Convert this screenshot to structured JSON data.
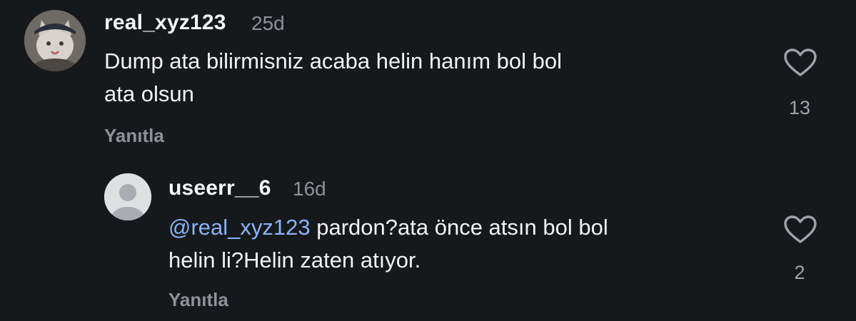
{
  "comments": [
    {
      "username": "real_xyz123",
      "time": "25d",
      "text_lines": [
        "Dump ata bilirmisniz acaba helin hanım bol bol",
        "ata olsun"
      ],
      "reply_label": "Yanıtla",
      "likes": "13",
      "avatar_icon": "cat-photo-avatar"
    },
    {
      "username": "useerr__6",
      "time": "16d",
      "mention": "@real_xyz123",
      "text_line1_rest": " pardon?ata önce atsın bol bol",
      "text_line2": "helin li?Helin zaten atıyor.",
      "reply_label": "Yanıtla",
      "likes": "2",
      "avatar_icon": "default-user-avatar"
    }
  ],
  "icons": {
    "like": "heart-outline-icon"
  },
  "colors": {
    "background": "#16191c",
    "text": "#f2f3f5",
    "muted": "#8e9297",
    "mention": "#8ab4f8"
  }
}
